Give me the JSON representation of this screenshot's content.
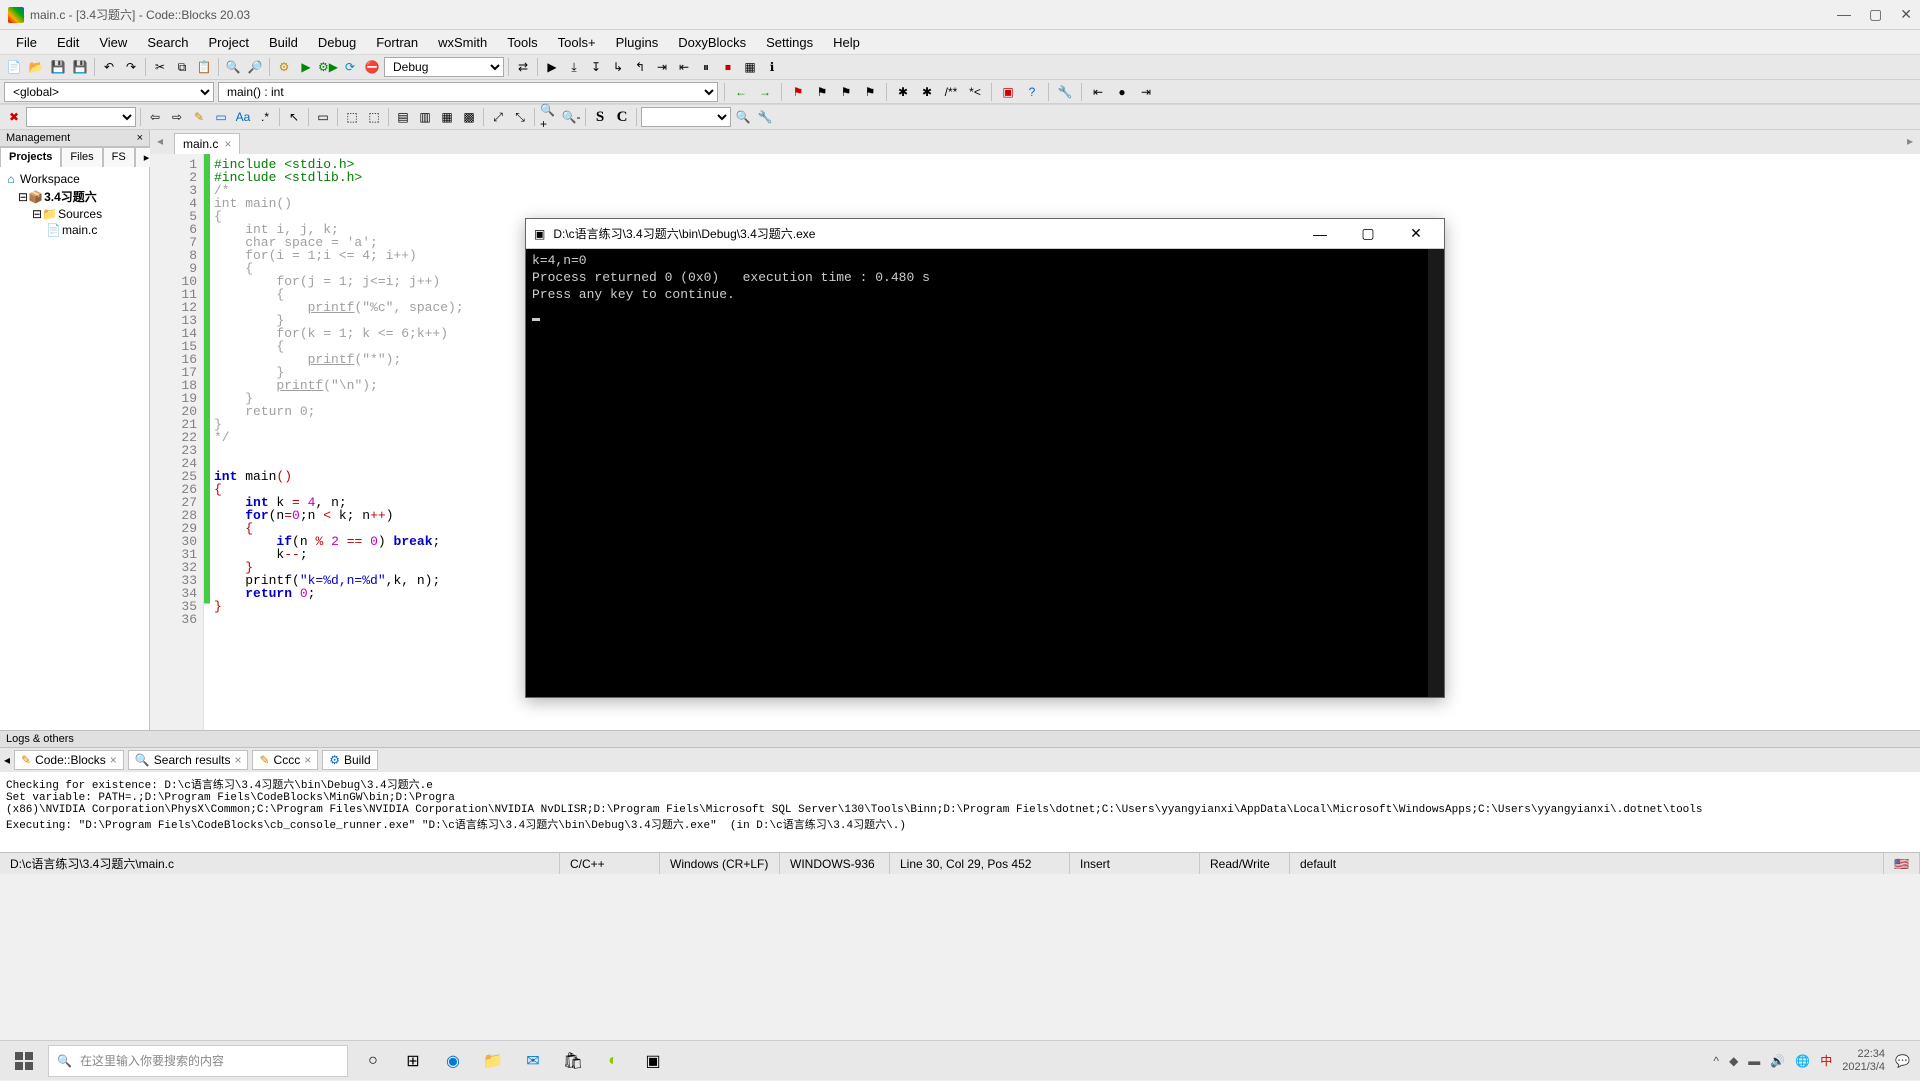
{
  "app": {
    "title": "main.c - [3.4习题六] - Code::Blocks 20.03"
  },
  "menu": [
    "File",
    "Edit",
    "View",
    "Search",
    "Project",
    "Build",
    "Debug",
    "Fortran",
    "wxSmith",
    "Tools",
    "Tools+",
    "Plugins",
    "DoxyBlocks",
    "Settings",
    "Help"
  ],
  "build_target": "Debug",
  "scope": {
    "global": "<global>",
    "symbol": "main() : int"
  },
  "management": {
    "title": "Management",
    "tabs": [
      "Projects",
      "Files",
      "FS"
    ],
    "active_tab": 0,
    "tree": {
      "workspace": "Workspace",
      "project": "3.4习题六",
      "folder": "Sources",
      "file": "main.c"
    }
  },
  "editor": {
    "tab": "main.c",
    "lines": [
      "1",
      "2",
      "3",
      "4",
      "5",
      "6",
      "7",
      "8",
      "9",
      "10",
      "11",
      "12",
      "13",
      "14",
      "15",
      "16",
      "17",
      "18",
      "19",
      "20",
      "21",
      "22",
      "23",
      "24",
      "25",
      "26",
      "27",
      "28",
      "29",
      "30",
      "31",
      "32",
      "33",
      "34",
      "35",
      "36"
    ]
  },
  "code": {
    "l1": "#include <stdio.h>",
    "l2": "#include <stdlib.h>",
    "l3": "/*",
    "l4": "int main()",
    "l5": "{",
    "l6": "    int i, j, k;",
    "l7": "    char space = 'a';",
    "l8": "    for(i = 1;i <= 4; i++)",
    "l9": "    {",
    "l10": "        for(j = 1; j<=i; j++)",
    "l11": "        {",
    "l12_a": "            ",
    "l12_fn": "printf",
    "l12_b": "(\"%c\", space);",
    "l13": "        }",
    "l14": "        for(k = 1; k <= 6;k++)",
    "l15": "        {",
    "l16_a": "            ",
    "l16_fn": "printf",
    "l16_b": "(\"*\");",
    "l17": "        }",
    "l18_a": "        ",
    "l18_fn": "printf",
    "l18_b": "(\"\\n\");",
    "l19": "    }",
    "l20": "    return 0;",
    "l21": "}",
    "l22": "*/",
    "l23": "",
    "l24": "",
    "l25_int": "int",
    "l25_main": " main",
    "l25_par": "()",
    "l26": "{",
    "l27_a": "    ",
    "l27_int": "int",
    "l27_b": " k ",
    "l27_eq": "=",
    "l27_c": " ",
    "l27_4": "4",
    "l27_d": ", n;",
    "l28_a": "    ",
    "l28_for": "for",
    "l28_b": "(n",
    "l28_eq": "=",
    "l28_0": "0",
    "l28_c": ";n ",
    "l28_lt": "<",
    "l28_d": " k; n",
    "l28_pp": "++",
    "l28_e": ")",
    "l29": "    {",
    "l30_a": "        ",
    "l30_if": "if",
    "l30_b": "(n ",
    "l30_pct": "%",
    "l30_c": " ",
    "l30_2": "2",
    "l30_d": " ",
    "l30_eq": "==",
    "l30_e": " ",
    "l30_0": "0",
    "l30_f": ") ",
    "l30_break": "break",
    "l30_g": ";",
    "l31_a": "        k",
    "l31_mm": "--",
    "l31_b": ";",
    "l32": "    }",
    "l33_a": "    printf(",
    "l33_str": "\"k=%d,n=%d\"",
    "l33_b": ",k, n);",
    "l34_a": "    ",
    "l34_ret": "return",
    "l34_b": " ",
    "l34_0": "0",
    "l34_c": ";",
    "l35": "}",
    "l36": ""
  },
  "console": {
    "title": "D:\\c语言练习\\3.4习题六\\bin\\Debug\\3.4习题六.exe",
    "line1": "k=4,n=0",
    "line2": "Process returned 0 (0x0)   execution time : 0.480 s",
    "line3": "Press any key to continue."
  },
  "logs": {
    "title": "Logs & others",
    "tabs": [
      "Code::Blocks",
      "Search results",
      "Cccc",
      "Build"
    ],
    "body": "Checking for existence: D:\\c语言练习\\3.4习题六\\bin\\Debug\\3.4习题六.e\nSet variable: PATH=.;D:\\Program Fiels\\CodeBlocks\\MinGW\\bin;D:\\Progra\n(x86)\\NVIDIA Corporation\\PhysX\\Common;C:\\Program Files\\NVIDIA Corporation\\NVIDIA NvDLISR;D:\\Program Fiels\\Microsoft SQL Server\\130\\Tools\\Binn;D:\\Program Fiels\\dotnet;C:\\Users\\yyangyianxi\\AppData\\Local\\Microsoft\\WindowsApps;C:\\Users\\yyangyianxi\\.dotnet\\tools\nExecuting: \"D:\\Program Fiels\\CodeBlocks\\cb_console_runner.exe\" \"D:\\c语言练习\\3.4习题六\\bin\\Debug\\3.4习题六.exe\"  (in D:\\c语言练习\\3.4习题六\\.)"
  },
  "status": {
    "path": "D:\\c语言练习\\3.4习题六\\main.c",
    "lang": "C/C++",
    "eol": "Windows (CR+LF)",
    "enc": "WINDOWS-936",
    "pos": "Line 30, Col 29, Pos 452",
    "ins": "Insert",
    "rw": "Read/Write",
    "profile": "default"
  },
  "taskbar": {
    "search_placeholder": "在这里输入你要搜索的内容",
    "time": "22:34",
    "date": "2021/3/4"
  }
}
